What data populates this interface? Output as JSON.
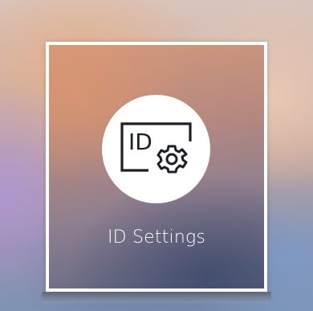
{
  "menu_item": {
    "label": "ID Settings",
    "icon": "id-settings-icon",
    "selected": true
  },
  "colors": {
    "tile_border": "#ffffff",
    "label": "#ffffff",
    "icon_stroke": "#1c1f26",
    "icon_background": "#ffffff"
  }
}
